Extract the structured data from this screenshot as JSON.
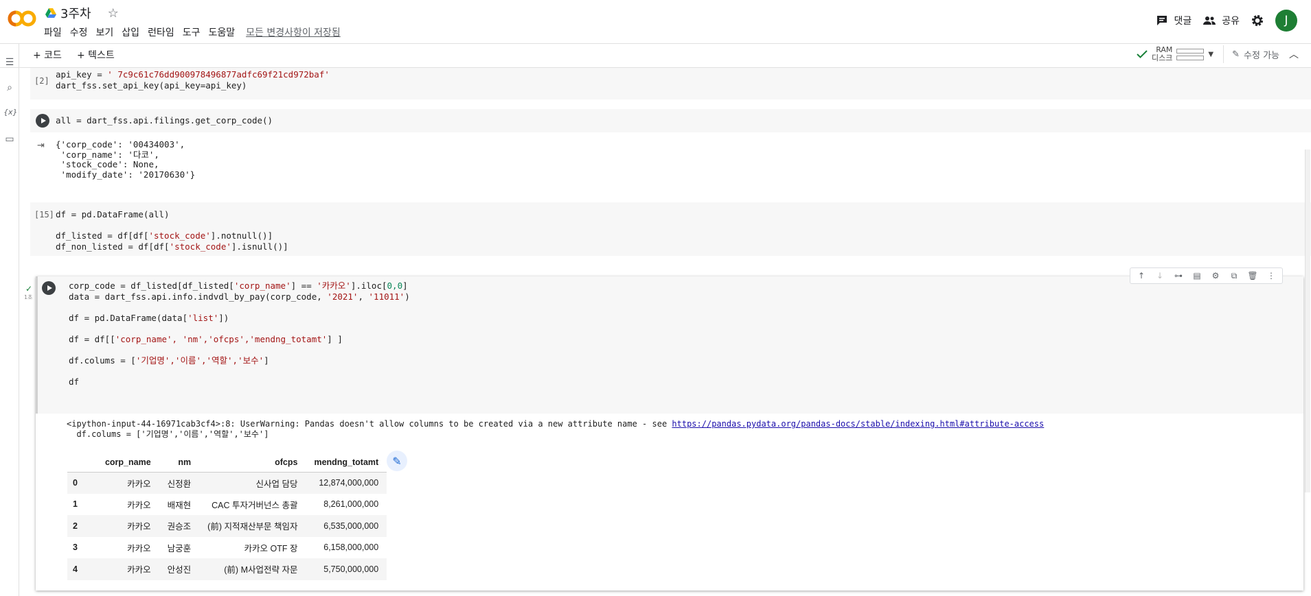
{
  "app": {
    "title": "3주차",
    "menu": [
      "파일",
      "수정",
      "보기",
      "삽입",
      "런타임",
      "도구",
      "도움말"
    ],
    "saved_status": "모든 변경사항이 저장됨",
    "comments_label": "댓글",
    "share_label": "공유",
    "avatar_letter": "J"
  },
  "toolbar": {
    "add_code": "+ 코드",
    "add_text": "+ 텍스트",
    "ram_label": "RAM",
    "disk_label": "디스크",
    "edit_mode": "수정 가능"
  },
  "cells": {
    "c1": {
      "count": "[2]",
      "line1_a": "api_key = ",
      "line1_str": "' 7c9c61c76dd900978496877adfc69f21cd972baf'",
      "line2": "dart_fss.set_api_key(api_key=api_key)"
    },
    "c2": {
      "code": "all = dart_fss.api.filings.get_corp_code()",
      "output": "{'corp_code': '00434003',\n 'corp_name': '다코',\n 'stock_code': None,\n 'modify_date': '20170630'}"
    },
    "c3": {
      "count": "[15]",
      "l1": "df = pd.DataFrame(all)",
      "l2_a": "df_listed = df[df[",
      "l2_s": "'stock_code'",
      "l2_b": "].notnull()]",
      "l3_a": "df_non_listed = df[df[",
      "l3_s": "'stock_code'",
      "l3_b": "].isnull()]"
    },
    "c4": {
      "l1_a": "corp_code = df_listed[df_listed[",
      "l1_s1": "'corp_name'",
      "l1_b": "] == ",
      "l1_s2": "'카카오'",
      "l1_c": "].iloc[",
      "l1_n": "0,0",
      "l1_d": "]",
      "l2_a": "data = dart_fss.api.info.indvdl_by_pay(corp_code, ",
      "l2_s1": "'2021'",
      "l2_b": ", ",
      "l2_s2": "'11011'",
      "l2_c": ")",
      "l3_a": "df = pd.DataFrame(data[",
      "l3_s": "'list'",
      "l3_b": "])",
      "l4_a": "df = df[[",
      "l4_s": "'corp_name', 'nm','ofcps','mendng_totamt'",
      "l4_b": "] ]",
      "l5_a": "df.colums = [",
      "l5_s": "'기업명','이름','역할','보수'",
      "l5_b": "]",
      "l6": "df",
      "warn_a": "<ipython-input-44-16971cab3cf4>:8: UserWarning: Pandas doesn't allow columns to be created via a new attribute name - see ",
      "warn_link": "https://pandas.pydata.org/pandas-docs/stable/indexing.html#attribute-access",
      "warn_b": "  df.colums = ['기업명','이름','역할','보수']",
      "time": "1초"
    }
  },
  "table": {
    "headers": [
      "corp_name",
      "nm",
      "ofcps",
      "mendng_totamt"
    ],
    "rows": [
      {
        "idx": "0",
        "corp_name": "카카오",
        "nm": "신정환",
        "ofcps": "신사업 담당",
        "amt": "12,874,000,000"
      },
      {
        "idx": "1",
        "corp_name": "카카오",
        "nm": "배재현",
        "ofcps": "CAC 투자거버넌스 총괄",
        "amt": "8,261,000,000"
      },
      {
        "idx": "2",
        "corp_name": "카카오",
        "nm": "권승조",
        "ofcps": "(前) 지적재산부문 책임자",
        "amt": "6,535,000,000"
      },
      {
        "idx": "3",
        "corp_name": "카카오",
        "nm": "남궁훈",
        "ofcps": "카카오 OTF 장",
        "amt": "6,158,000,000"
      },
      {
        "idx": "4",
        "corp_name": "카카오",
        "nm": "안성진",
        "ofcps": "(前) M사업전략 자문",
        "amt": "5,750,000,000"
      }
    ]
  },
  "icons": {
    "comment": "comment-icon",
    "share": "people-icon",
    "settings": "gear-icon",
    "star": "star-icon",
    "run": "play-icon",
    "output": "output-icon",
    "magic": "magic-wand-icon"
  },
  "colors": {
    "accent_orange": "#f9ab00",
    "string_red": "#a31515",
    "number_green": "#098658",
    "check_green": "#188038",
    "avatar_green": "#1e7e34"
  }
}
